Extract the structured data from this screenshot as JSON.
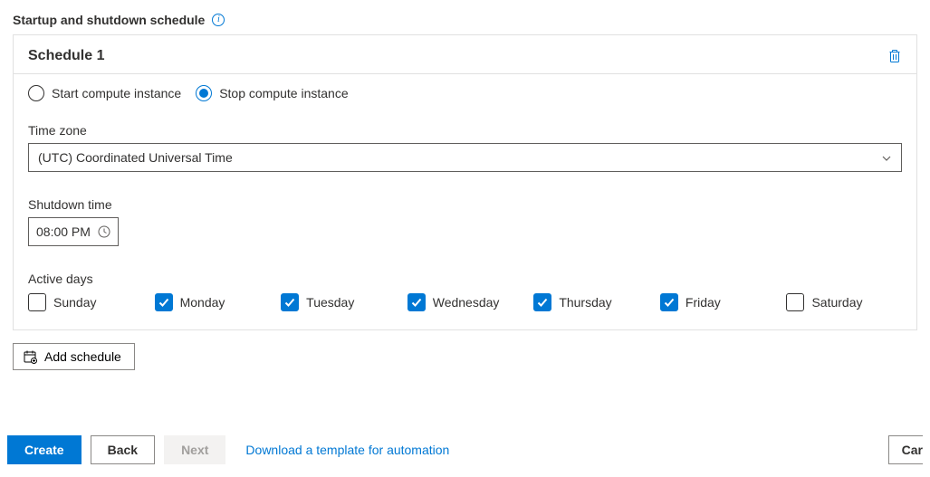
{
  "page": {
    "title": "Startup and shutdown schedule"
  },
  "schedule": {
    "title": "Schedule 1",
    "radios": {
      "start": {
        "label": "Start compute instance",
        "selected": false
      },
      "stop": {
        "label": "Stop compute instance",
        "selected": true
      }
    },
    "timezone": {
      "label": "Time zone",
      "value": "(UTC) Coordinated Universal Time"
    },
    "shutdown_time": {
      "label": "Shutdown time",
      "value": "08:00 PM"
    },
    "active_days": {
      "label": "Active days",
      "days": [
        {
          "name": "Sunday",
          "checked": false
        },
        {
          "name": "Monday",
          "checked": true
        },
        {
          "name": "Tuesday",
          "checked": true
        },
        {
          "name": "Wednesday",
          "checked": true
        },
        {
          "name": "Thursday",
          "checked": true
        },
        {
          "name": "Friday",
          "checked": true
        },
        {
          "name": "Saturday",
          "checked": false
        }
      ]
    }
  },
  "add_schedule_label": "Add schedule",
  "footer": {
    "create": "Create",
    "back": "Back",
    "next": "Next",
    "download_link": "Download a template for automation",
    "cancel": "Cancel"
  }
}
